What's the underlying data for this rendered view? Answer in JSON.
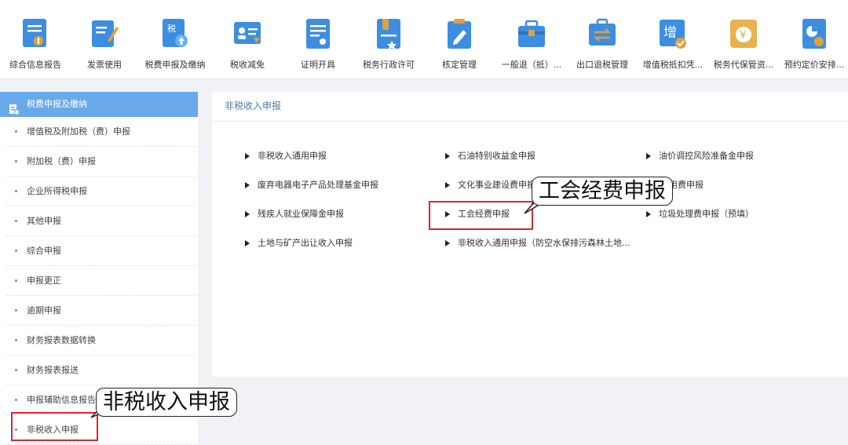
{
  "toolbar": {
    "items": [
      {
        "label": "综合信息报告",
        "icon": "report-icon",
        "color": "#3d8ee0"
      },
      {
        "label": "发票使用",
        "icon": "invoice-pen-icon",
        "color": "#3d8ee0"
      },
      {
        "label": "税费申报及缴纳",
        "icon": "tax-upload-icon",
        "color": "#3d8ee0"
      },
      {
        "label": "税收减免",
        "icon": "tax-relief-card-icon",
        "color": "#3d8ee0"
      },
      {
        "label": "证明开具",
        "icon": "certificate-icon",
        "color": "#3d8ee0"
      },
      {
        "label": "税务行政许可",
        "icon": "permit-icon",
        "color": "#3d8ee0"
      },
      {
        "label": "核定管理",
        "icon": "clipboard-edit-icon",
        "color": "#3d8ee0"
      },
      {
        "label": "一般退（抵）...",
        "icon": "briefcase-icon",
        "color": "#3d8ee0"
      },
      {
        "label": "出口退税管理",
        "icon": "export-refund-icon",
        "color": "#3d8ee0"
      },
      {
        "label": "增值税抵扣凭...",
        "icon": "vat-deduct-icon",
        "color": "#3d8ee0"
      },
      {
        "label": "税务代保管资...",
        "icon": "money-bag-icon",
        "color": "#e0a23d"
      },
      {
        "label": "预约定价安排...",
        "icon": "pricing-icon",
        "color": "#3d8ee0"
      }
    ]
  },
  "sidebar": {
    "header": "税费申报及缴纳",
    "items": [
      {
        "label": "增值税及附加税（费）申报"
      },
      {
        "label": "附加税（费）申报"
      },
      {
        "label": "企业所得税申报"
      },
      {
        "label": "其他申报"
      },
      {
        "label": "综合申报"
      },
      {
        "label": "申报更正"
      },
      {
        "label": "逾期申报"
      },
      {
        "label": "财务报表数据转换"
      },
      {
        "label": "财务报表报送"
      },
      {
        "label": "申报辅助信息报告"
      },
      {
        "label": "非税收入申报"
      }
    ]
  },
  "main": {
    "title": "非税收入申报",
    "links": [
      {
        "label": "非税收入通用申报"
      },
      {
        "label": "石油特别收益金申报"
      },
      {
        "label": "油价调控风险准备金申报"
      },
      {
        "label": "废弃电器电子产品处理基金申报"
      },
      {
        "label": "文化事业建设费申报"
      },
      {
        "label": "用费申报"
      },
      {
        "label": "残疾人就业保障金申报"
      },
      {
        "label": "工会经费申报"
      },
      {
        "label": "垃圾处理费申报（预填）"
      },
      {
        "label": "土地与矿产出让收入申报"
      },
      {
        "label": "非税收入通用申报（防空水保排污森林土地..."
      }
    ]
  },
  "annotations": {
    "callout_main": "工会经费申报",
    "callout_side": "非税收入申报",
    "highlight_color": "#e0252b"
  }
}
